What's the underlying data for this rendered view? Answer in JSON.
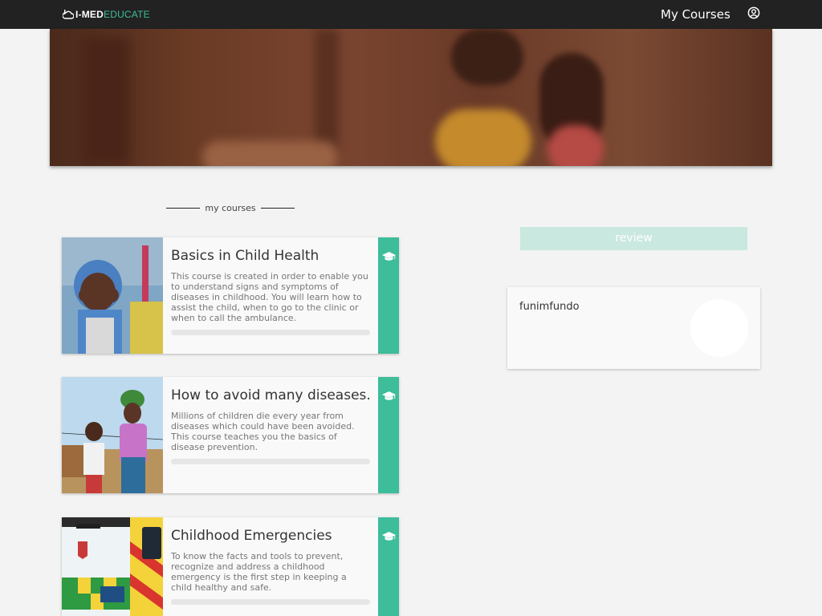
{
  "header": {
    "logo_prefix": "I-MED",
    "logo_suffix": "EDUCATE",
    "nav_my_courses": "My Courses",
    "user_icon": "user-circle-icon"
  },
  "hero": {
    "image_alt": "banner photo"
  },
  "section": {
    "label": "my courses"
  },
  "courses": [
    {
      "title": "Basics in Child Health",
      "description": "This course is created in order to enable you to understand signs and symptoms of diseases in childhood. You will learn how to assist the child, when to go to the clinic or when to call the ambulance.",
      "icon": "graduation-cap-icon",
      "progress": 0
    },
    {
      "title": "How to avoid many diseases.",
      "description": "Millions of children die every year from diseases which could have been avoided. This course teaches you the basics of disease prevention.",
      "icon": "graduation-cap-icon",
      "progress": 0
    },
    {
      "title": "Childhood Emergencies",
      "description": "To know the facts and tools to prevent, recognize and address a childhood emergency is the first step in keeping a child healthy and safe.",
      "icon": "graduation-cap-icon",
      "progress": 0
    }
  ],
  "sidebar": {
    "review_label": "review",
    "profile_name": "funimfundo"
  },
  "colors": {
    "topbar": "#222222",
    "accent": "#3dbd9a",
    "review_bg": "#c9e8df",
    "background": "#f3f3f3"
  }
}
